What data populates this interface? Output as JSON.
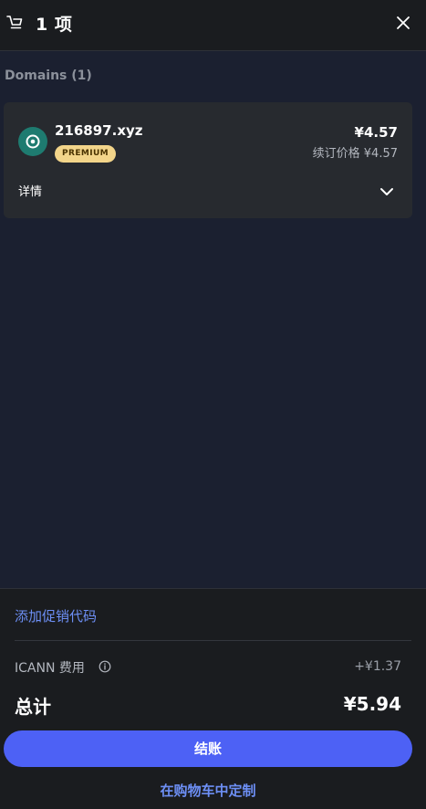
{
  "header": {
    "title": "1 项",
    "cart_icon": "cart-icon",
    "close_icon": "close-icon"
  },
  "section": {
    "heading": "Domains (1)"
  },
  "domain_item": {
    "name": "216897.xyz",
    "badge": "PREMIUM",
    "price": "¥4.57",
    "renewal": "续订价格 ¥4.57",
    "details_label": "详情",
    "icon": "domain-target-icon",
    "chevron_icon": "chevron-down-icon"
  },
  "summary": {
    "promo_link": "添加促销代码",
    "fee_label": "ICANN 费用",
    "fee_value": "+¥1.37",
    "total_label": "总计",
    "total_value": "¥5.94",
    "checkout_label": "结账",
    "customize_link": "在购物车中定制",
    "info_icon": "info-icon"
  },
  "colors": {
    "background": "#1b2030",
    "panel": "#1a1c1f",
    "card": "#272a2f",
    "accent": "#4d61f5",
    "link": "#6d8ff5",
    "premium_badge": "#f3d58a",
    "domain_icon": "#1e7b70"
  }
}
